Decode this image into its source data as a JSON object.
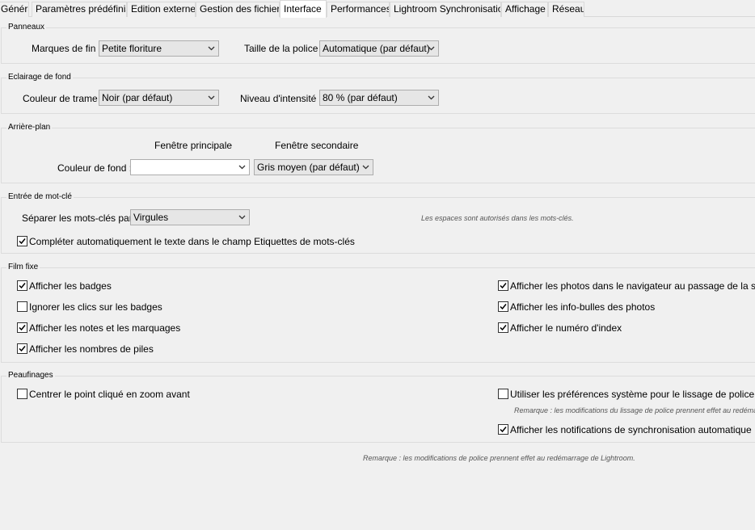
{
  "tabs": [
    {
      "label": "Général"
    },
    {
      "label": "Paramètres prédéfinis"
    },
    {
      "label": "Edition externe"
    },
    {
      "label": "Gestion des fichiers"
    },
    {
      "label": "Interface",
      "active": true
    },
    {
      "label": "Performances"
    },
    {
      "label": "Lightroom Synchronisation"
    },
    {
      "label": "Affichage"
    },
    {
      "label": "Réseau"
    }
  ],
  "panneaux": {
    "title": "Panneaux",
    "end_marks_label": "Marques de fin :",
    "end_marks_value": "Petite floriture",
    "font_size_label": "Taille de la police :",
    "font_size_value": "Automatique (par défaut)"
  },
  "eclairage": {
    "title": "Eclairage de fond",
    "screen_color_label": "Couleur de trame :",
    "screen_color_value": "Noir (par défaut)",
    "intensity_label": "Niveau d'intensité :",
    "intensity_value": "80 % (par défaut)"
  },
  "arriere_plan": {
    "title": "Arrière-plan",
    "main_window_header": "Fenêtre principale",
    "secondary_window_header": "Fenêtre secondaire",
    "bg_color_label": "Couleur de fond :",
    "main_value": "",
    "secondary_value": "Gris moyen (par défaut)"
  },
  "mot_cle": {
    "title": "Entrée de mot-clé",
    "separator_label": "Séparer les mots-clés par :",
    "separator_value": "Virgules",
    "spaces_note": "Les espaces sont autorisés dans les mots-clés.",
    "autocomplete_label": "Compléter automatiquement le texte dans le champ Etiquettes de mots-clés",
    "autocomplete_checked": true
  },
  "film_fixe": {
    "title": "Film fixe",
    "left": [
      {
        "label": "Afficher les badges",
        "checked": true
      },
      {
        "label": "Ignorer les clics sur les badges",
        "checked": false
      },
      {
        "label": "Afficher les notes et les marquages",
        "checked": true
      },
      {
        "label": "Afficher les nombres de piles",
        "checked": true
      }
    ],
    "right": [
      {
        "label": "Afficher les photos dans le navigateur au passage de la souris",
        "checked": true
      },
      {
        "label": "Afficher les info-bulles des photos",
        "checked": true
      },
      {
        "label": "Afficher le numéro d'index",
        "checked": true
      }
    ]
  },
  "peaufinages": {
    "title": "Peaufinages",
    "zoom_center_label": "Centrer le point cliqué en zoom avant",
    "zoom_center_checked": false,
    "system_smoothing_label": "Utiliser les préférences système pour le lissage de police",
    "system_smoothing_checked": false,
    "smoothing_note": "Remarque : les modifications du lissage de police prennent effet au redémarrage",
    "sync_notifications_label": "Afficher les notifications de synchronisation automatique",
    "sync_notifications_checked": true
  },
  "footer_note": "Remarque : les modifications de police prennent effet au redémarrage de Lightroom.",
  "icons": {
    "dropdown": "chevron-down-icon",
    "check": "checkmark-icon"
  }
}
